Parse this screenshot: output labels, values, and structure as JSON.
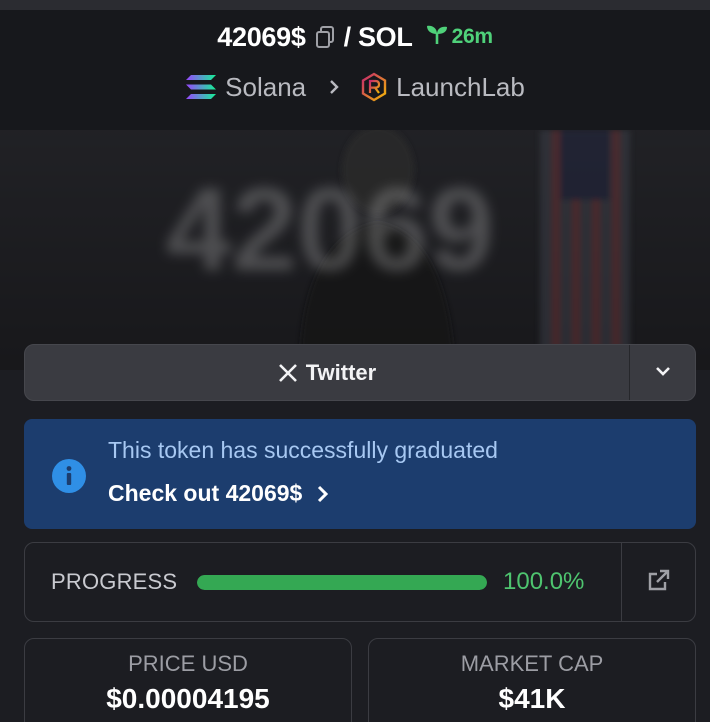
{
  "token": {
    "symbol": "42069$",
    "pair": "/ SOL",
    "age": "26m"
  },
  "breadcrumb": {
    "chain": "Solana",
    "platform": "LaunchLab"
  },
  "banner": {
    "image_text": "42069"
  },
  "twitter": {
    "label": "Twitter"
  },
  "notice": {
    "message": "This token has successfully graduated",
    "link": "Check out 42069$"
  },
  "progress": {
    "label": "PROGRESS",
    "value_text": "100.0%",
    "fraction": 1.0
  },
  "stats": {
    "price_label": "PRICE USD",
    "price_value": "$0.00004195",
    "mcap_label": "MARKET CAP",
    "mcap_value": "$41K"
  },
  "colors": {
    "accent_green": "#4ec46f",
    "notice_bg": "#1c3d6e",
    "notice_text": "#a7c8f2",
    "info_icon": "#2f8fe6"
  },
  "icons": [
    "copy-icon",
    "sprout-icon",
    "solana-logo-icon",
    "chevron-right-icon",
    "launchlab-logo-icon",
    "x-logo-icon",
    "chevron-down-icon",
    "info-icon",
    "external-link-icon"
  ]
}
